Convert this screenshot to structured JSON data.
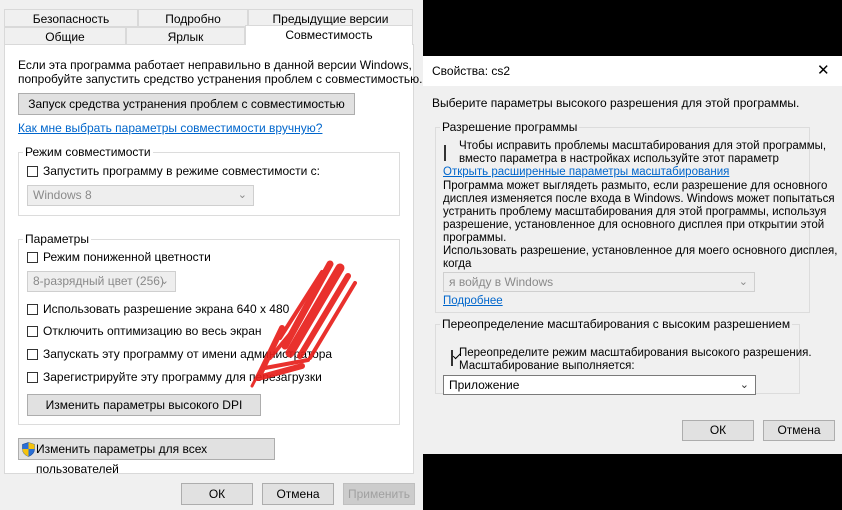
{
  "left_window": {
    "tabs_row1": [
      "Безопасность",
      "Подробно",
      "Предыдущие версии"
    ],
    "tabs_row2": [
      "Общие",
      "Ярлык",
      "Совместимость"
    ],
    "intro_text_line1": "Если эта программа работает неправильно в данной версии Windows,",
    "intro_text_line2": "попробуйте запустить средство устранения проблем с совместимостью.",
    "troubleshooter_button": "Запуск средства устранения проблем с совместимостью",
    "manual_link": "Как мне выбрать параметры совместимости вручную?",
    "compat_mode": {
      "title": "Режим совместимости",
      "checkbox_label": "Запустить программу в режиме совместимости с:",
      "checked": false,
      "dropdown_value": "Windows 8"
    },
    "params": {
      "title": "Параметры",
      "reduced_color_label": "Режим пониженной цветности",
      "color_dropdown_value": "8-разрядный цвет (256)",
      "res_640_label": "Использовать разрешение экрана 640 x 480",
      "fullscreen_opt_label": "Отключить оптимизацию во весь экран",
      "admin_label": "Запускать эту программу от имени администратора",
      "register_label": "Зарегистрируйте эту программу для перезагрузки",
      "dpi_button": "Изменить параметры высокого DPI"
    },
    "all_users_button": "Изменить параметры для всех пользователей",
    "ok_button": "ОК",
    "cancel_button": "Отмена",
    "apply_button": "Применить"
  },
  "right_window": {
    "title": "Свойства: cs2",
    "close_glyph": "✕",
    "heading": "Выберите параметры высокого разрешения для этой программы.",
    "program_res": {
      "title": "Разрешение программы",
      "checkbox_line1": "Чтобы исправить проблемы масштабирования для этой программы,",
      "checkbox_line2": "вместо параметра в настройках используйте этот параметр",
      "checked": false,
      "link": "Открыть расширенные параметры масштабирования",
      "para_lines": [
        "Программа может выглядеть размыто, если разрешение для основного",
        "дисплея изменяется после входа в Windows. Windows может попытаться",
        "устранить проблему масштабирования для этой программы, используя",
        "разрешение, установленное для основного дисплея при открытии этой",
        "программы."
      ],
      "use_res_line1": "Использовать разрешение, установленное для моего основного дисплея,",
      "use_res_line2": "когда",
      "dropdown_value": "я войду в Windows",
      "more_link": "Подробнее"
    },
    "override": {
      "title": "Переопределение масштабирования с высоким разрешением",
      "checkbox_line1": "Переопределите режим масштабирования высокого разрешения.",
      "checkbox_line2": "Масштабирование выполняется:",
      "checked": true,
      "dropdown_value": "Приложение"
    },
    "ok_button": "ОК",
    "cancel_button": "Отмена"
  },
  "colors": {
    "window_bg": "#f0f0f0",
    "panel_bg": "#ffffff",
    "link": "#0066cc",
    "annotation_arrow": "#e8201c",
    "shield_blue": "#2a6fd6",
    "shield_yellow": "#f4c20d"
  }
}
